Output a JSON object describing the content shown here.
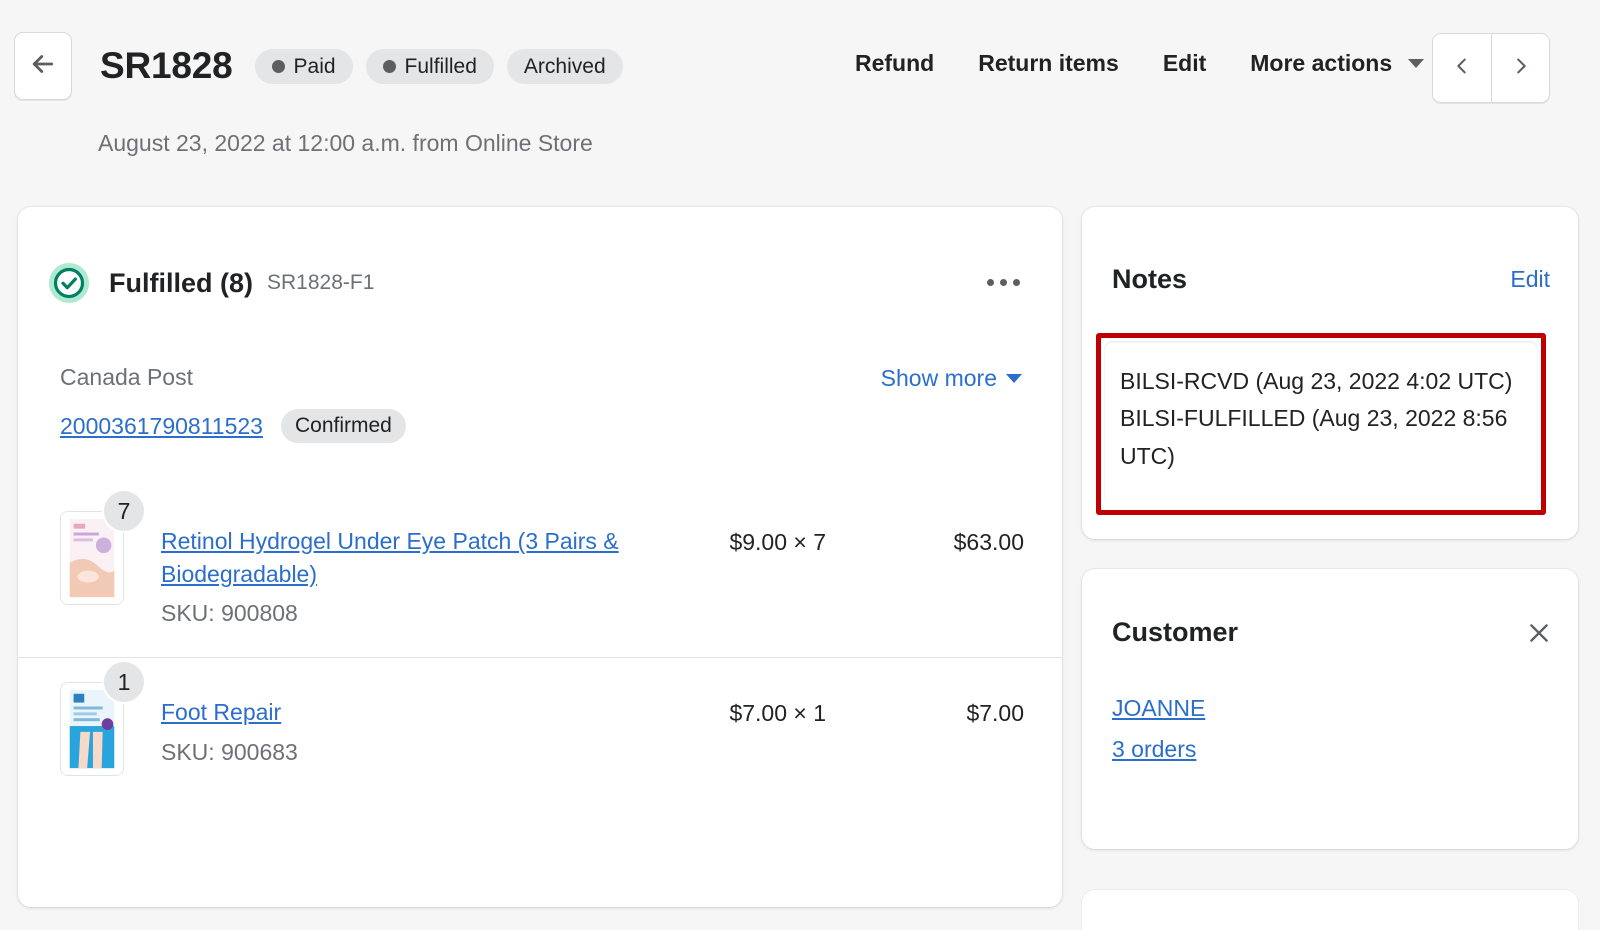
{
  "header": {
    "back_icon": "arrow-left-icon",
    "order_name": "SR1828",
    "badges": [
      {
        "label": "Paid",
        "has_dot": true
      },
      {
        "label": "Fulfilled",
        "has_dot": true
      },
      {
        "label": "Archived",
        "has_dot": false
      }
    ],
    "actions": [
      {
        "label": "Refund"
      },
      {
        "label": "Return items"
      },
      {
        "label": "Edit"
      },
      {
        "label": "More actions",
        "has_caret": true
      }
    ],
    "prev_icon": "chevron-left-icon",
    "next_icon": "chevron-right-icon",
    "subtitle": "August 23, 2022 at 12:00 a.m. from Online Store"
  },
  "fulfillment": {
    "status_icon": "check-circle-icon",
    "title": "Fulfilled (8)",
    "reference": "SR1828-F1",
    "more_menu_icon": "kebab-menu-icon",
    "carrier": "Canada Post",
    "show_more_label": "Show more",
    "tracking_number": "2000361790811523",
    "tracking_status": "Confirmed",
    "items": [
      {
        "quantity": "7",
        "title": "Retinol Hydrogel Under Eye Patch (3 Pairs & Biodegradable)",
        "sku": "SKU: 900808",
        "unit_price": "$9.00 × 7",
        "total_price": "$63.00",
        "thumb_style": "pink"
      },
      {
        "quantity": "1",
        "title": "Foot Repair",
        "sku": "SKU: 900683",
        "unit_price": "$7.00 × 1",
        "total_price": "$7.00",
        "thumb_style": "blue"
      }
    ]
  },
  "notes": {
    "title": "Notes",
    "edit_label": "Edit",
    "body": "BILSI-RCVD (Aug 23, 2022 4:02 UTC) BILSI-FULFILLED (Aug 23, 2022 8:56 UTC)",
    "highlight_color": "#c00000"
  },
  "customer": {
    "title": "Customer",
    "close_icon": "close-icon",
    "name": "JOANNE",
    "orders_count": "3 orders"
  },
  "colors": {
    "page_background": "#f6f6f7",
    "card_background": "#ffffff",
    "link": "#2c6ecb",
    "text": "#202223",
    "subdued": "#6d7175",
    "badge_background": "#e4e5e7",
    "success": "#008060",
    "success_background": "#aee9d1",
    "highlight": "#c00000"
  }
}
